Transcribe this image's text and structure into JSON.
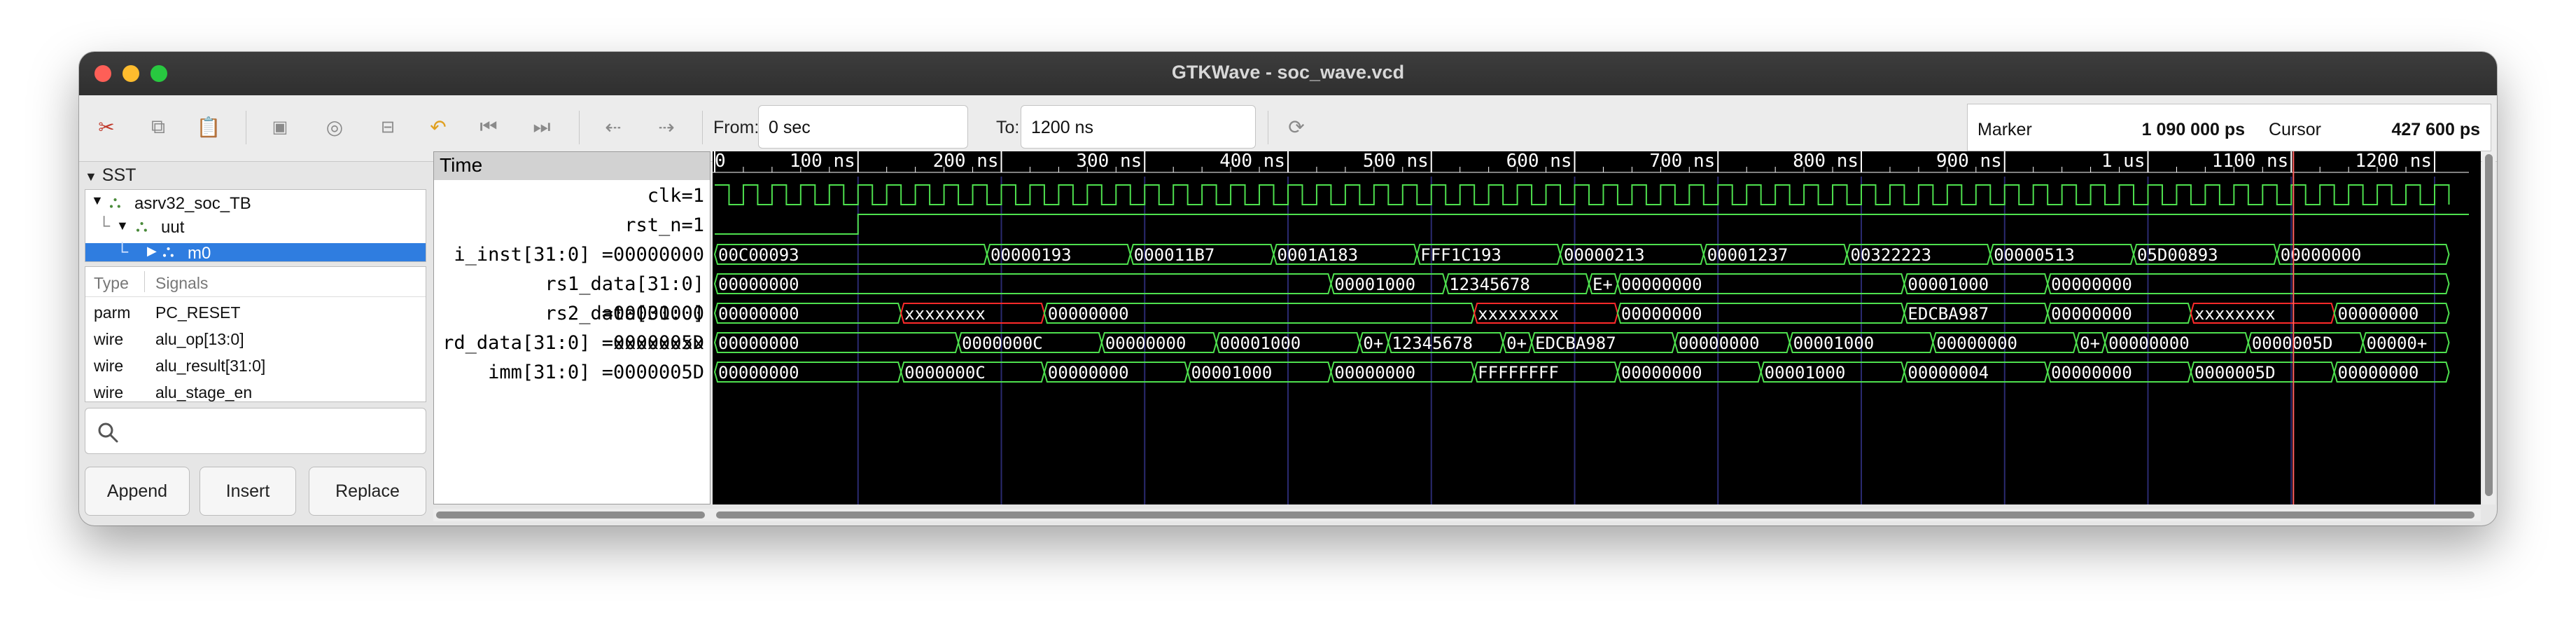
{
  "window": {
    "title": "GTKWave - soc_wave.vcd"
  },
  "colors": {
    "wave": "#4ee04e",
    "x_state": "#ff2a2a",
    "marker": "#ff6060",
    "grid": "#2a2a70",
    "ruler_text": "#ffffff",
    "selected": "#2f7de0"
  },
  "toolbar": {
    "icons": [
      "cut-icon",
      "copy-icon",
      "paste-icon",
      "zoom-fit-icon",
      "zoom-in-icon",
      "zoom-out-icon",
      "undo-icon",
      "go-to-start-icon",
      "go-to-end-icon",
      "previous-edge-icon",
      "next-edge-icon",
      "reload-icon"
    ],
    "from_label": "From:",
    "from_value": "0 sec",
    "to_label": "To:",
    "to_value": "1200 ns",
    "marker_label": "Marker",
    "marker_value": "1 090 000 ps",
    "cursor_label": "Cursor",
    "cursor_value": "427 600 ps"
  },
  "sst": {
    "title": "SST",
    "tree": [
      {
        "label": "asrv32_soc_TB",
        "level": 0
      },
      {
        "label": "uut",
        "level": 1
      },
      {
        "label": "m0",
        "level": 2,
        "selected": true
      }
    ],
    "columns": {
      "type": "Type",
      "signals": "Signals"
    },
    "signals": [
      {
        "type": "parm",
        "name": "PC_RESET"
      },
      {
        "type": "wire",
        "name": "alu_op[13:0]"
      },
      {
        "type": "wire",
        "name": "alu_result[31:0]"
      },
      {
        "type": "wire",
        "name": "alu_stage_en"
      }
    ],
    "search_placeholder": "",
    "buttons": {
      "append": "Append",
      "insert": "Insert",
      "replace": "Replace"
    }
  },
  "waves": {
    "header": "Time",
    "signal_names": [
      "clk=1",
      "rst_n=1",
      "i_inst[31:0] =00000000",
      "rs1_data[31:0] =00000000",
      "rs2_data[31:0] =xxxxxxxx",
      "rd_data[31:0] =0000005D",
      "imm[31:0] =0000005D"
    ],
    "time_range": [
      0,
      1200
    ],
    "time_unit": "ns",
    "ruler_ticks": [
      {
        "t": 0,
        "label": "0"
      },
      {
        "t": 100,
        "label": "100 ns"
      },
      {
        "t": 200,
        "label": "200 ns"
      },
      {
        "t": 300,
        "label": "300 ns"
      },
      {
        "t": 400,
        "label": "400 ns"
      },
      {
        "t": 500,
        "label": "500 ns"
      },
      {
        "t": 600,
        "label": "600 ns"
      },
      {
        "t": 700,
        "label": "700 ns"
      },
      {
        "t": 800,
        "label": "800 ns"
      },
      {
        "t": 900,
        "label": "900 ns"
      },
      {
        "t": 1000,
        "label": "1 us"
      },
      {
        "t": 1100,
        "label": "1100 ns"
      },
      {
        "t": 1200,
        "label": "1200 ns"
      }
    ],
    "clock_period_ns": 20,
    "rst_release_ns": 100,
    "cursor_ns": 1101.5,
    "buses": [
      {
        "name": "i_inst",
        "segments": [
          {
            "s": 0,
            "e": 190,
            "v": "00C00093"
          },
          {
            "s": 190,
            "e": 290,
            "v": "00000193"
          },
          {
            "s": 290,
            "e": 390,
            "v": "000011B7"
          },
          {
            "s": 390,
            "e": 490,
            "v": "0001A183"
          },
          {
            "s": 490,
            "e": 590,
            "v": "FFF1C193"
          },
          {
            "s": 590,
            "e": 690,
            "v": "00000213"
          },
          {
            "s": 690,
            "e": 790,
            "v": "00001237"
          },
          {
            "s": 790,
            "e": 890,
            "v": "00322223"
          },
          {
            "s": 890,
            "e": 990,
            "v": "00000513"
          },
          {
            "s": 990,
            "e": 1090,
            "v": "05D00893"
          },
          {
            "s": 1090,
            "e": 1210,
            "v": "00000000"
          }
        ]
      },
      {
        "name": "rs1_data",
        "segments": [
          {
            "s": 0,
            "e": 430,
            "v": "00000000"
          },
          {
            "s": 430,
            "e": 510,
            "v": "00001000"
          },
          {
            "s": 510,
            "e": 610,
            "v": "12345678"
          },
          {
            "s": 610,
            "e": 630,
            "v": "E+"
          },
          {
            "s": 630,
            "e": 830,
            "v": "00000000"
          },
          {
            "s": 830,
            "e": 930,
            "v": "00001000"
          },
          {
            "s": 930,
            "e": 1210,
            "v": "00000000"
          }
        ]
      },
      {
        "name": "rs2_data",
        "segments": [
          {
            "s": 0,
            "e": 130,
            "v": "00000000"
          },
          {
            "s": 130,
            "e": 230,
            "v": "xxxxxxxx",
            "x": true
          },
          {
            "s": 230,
            "e": 530,
            "v": "00000000"
          },
          {
            "s": 530,
            "e": 630,
            "v": "xxxxxxxx",
            "x": true
          },
          {
            "s": 630,
            "e": 830,
            "v": "00000000"
          },
          {
            "s": 830,
            "e": 930,
            "v": "EDCBA987"
          },
          {
            "s": 930,
            "e": 1030,
            "v": "00000000"
          },
          {
            "s": 1030,
            "e": 1130,
            "v": "xxxxxxxx",
            "x": true
          },
          {
            "s": 1130,
            "e": 1210,
            "v": "00000000"
          }
        ]
      },
      {
        "name": "rd_data",
        "segments": [
          {
            "s": 0,
            "e": 170,
            "v": "00000000"
          },
          {
            "s": 170,
            "e": 270,
            "v": "0000000C"
          },
          {
            "s": 270,
            "e": 350,
            "v": "00000000"
          },
          {
            "s": 350,
            "e": 450,
            "v": "00001000"
          },
          {
            "s": 450,
            "e": 470,
            "v": "0+"
          },
          {
            "s": 470,
            "e": 550,
            "v": "12345678"
          },
          {
            "s": 550,
            "e": 570,
            "v": "0+"
          },
          {
            "s": 570,
            "e": 670,
            "v": "EDCBA987"
          },
          {
            "s": 670,
            "e": 750,
            "v": "00000000"
          },
          {
            "s": 750,
            "e": 850,
            "v": "00001000"
          },
          {
            "s": 850,
            "e": 950,
            "v": "00000000"
          },
          {
            "s": 950,
            "e": 970,
            "v": "0+"
          },
          {
            "s": 970,
            "e": 1070,
            "v": "00000000"
          },
          {
            "s": 1070,
            "e": 1150,
            "v": "0000005D"
          },
          {
            "s": 1150,
            "e": 1210,
            "v": "00000+"
          }
        ]
      },
      {
        "name": "imm",
        "segments": [
          {
            "s": 0,
            "e": 130,
            "v": "00000000"
          },
          {
            "s": 130,
            "e": 230,
            "v": "0000000C"
          },
          {
            "s": 230,
            "e": 330,
            "v": "00000000"
          },
          {
            "s": 330,
            "e": 430,
            "v": "00001000"
          },
          {
            "s": 430,
            "e": 530,
            "v": "00000000"
          },
          {
            "s": 530,
            "e": 630,
            "v": "FFFFFFFF"
          },
          {
            "s": 630,
            "e": 730,
            "v": "00000000"
          },
          {
            "s": 730,
            "e": 830,
            "v": "00001000"
          },
          {
            "s": 830,
            "e": 930,
            "v": "00000004"
          },
          {
            "s": 930,
            "e": 1030,
            "v": "00000000"
          },
          {
            "s": 1030,
            "e": 1130,
            "v": "0000005D"
          },
          {
            "s": 1130,
            "e": 1210,
            "v": "00000000"
          }
        ]
      }
    ]
  }
}
